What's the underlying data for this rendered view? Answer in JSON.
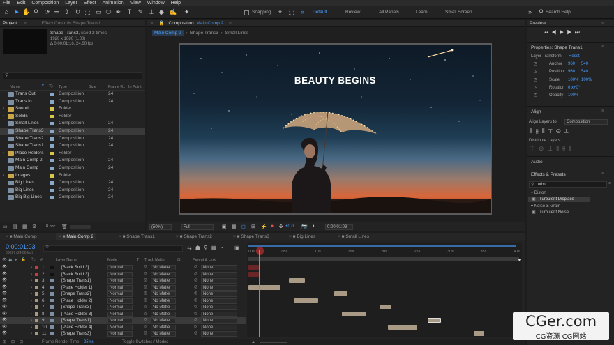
{
  "menu": [
    "File",
    "Edit",
    "Composition",
    "Layer",
    "Effect",
    "Animation",
    "View",
    "Window",
    "Help"
  ],
  "toolbar": {
    "snapping": "Snapping",
    "workspaces": [
      "Default",
      "Review",
      "All Panels",
      "Learn",
      "Small Screen"
    ],
    "search_placeholder": "Search Help"
  },
  "project": {
    "tab": "Project",
    "effects_tab": "Effect Controls Shape Trans1",
    "selected": "Shape Trans3",
    "used": ", used 2 times",
    "dims": "1920 x 1080 (1.00)",
    "duration": "Δ 0:00:01:16, 24.00 fps",
    "columns": [
      "Name",
      "Type",
      "Size",
      "Frame R...",
      "In Point"
    ],
    "bpc": "8 bpc",
    "items": [
      {
        "name": "Trans Out",
        "type": "Composition",
        "rate": "24",
        "color": "#8aa8c8",
        "kind": "comp"
      },
      {
        "name": "Trans In",
        "type": "Composition",
        "rate": "24",
        "color": "#8aa8c8",
        "kind": "comp"
      },
      {
        "name": "Sound",
        "type": "Folder",
        "rate": "",
        "color": "#d8c84a",
        "kind": "folder"
      },
      {
        "name": "Solids",
        "type": "Folder",
        "rate": "",
        "color": "#d8c84a",
        "kind": "folder"
      },
      {
        "name": "Small Lines",
        "type": "Composition",
        "rate": "24",
        "color": "#8aa8c8",
        "kind": "comp"
      },
      {
        "name": "Shape Trans3",
        "type": "Composition",
        "rate": "24",
        "color": "#8aa8c8",
        "kind": "comp"
      },
      {
        "name": "Shape Trans2",
        "type": "Composition",
        "rate": "24",
        "color": "#8aa8c8",
        "kind": "comp"
      },
      {
        "name": "Shape Trans1",
        "type": "Composition",
        "rate": "24",
        "color": "#8aa8c8",
        "kind": "comp"
      },
      {
        "name": "Place Holders",
        "type": "Folder",
        "rate": "",
        "color": "#d8c84a",
        "kind": "folder"
      },
      {
        "name": "Main Comp 2",
        "type": "Composition",
        "rate": "24",
        "color": "#8aa8c8",
        "kind": "comp"
      },
      {
        "name": "Main Comp",
        "type": "Composition",
        "rate": "24",
        "color": "#8aa8c8",
        "kind": "comp"
      },
      {
        "name": "Images",
        "type": "Folder",
        "rate": "",
        "color": "#d8c84a",
        "kind": "folder"
      },
      {
        "name": "Big Lines",
        "type": "Composition",
        "rate": "24",
        "color": "#8aa8c8",
        "kind": "comp"
      },
      {
        "name": "Big Lines",
        "type": "Composition",
        "rate": "24",
        "color": "#8aa8c8",
        "kind": "comp"
      },
      {
        "name": "Big Big Lines",
        "type": "Composition",
        "rate": "24",
        "color": "#8aa8c8",
        "kind": "comp"
      }
    ]
  },
  "comp": {
    "tab_prefix": "Composition",
    "tab_name": "Main Comp 2",
    "crumbs": [
      "Main Comp 2",
      "Shape Trans3",
      "Small Lines"
    ],
    "headline": "BEAUTY BEGINS",
    "zoom": "(50%)",
    "quality": "Full",
    "exposure": "+0.0",
    "timecode": "0:00:01:03"
  },
  "preview": {
    "title": "Preview"
  },
  "properties": {
    "title": "Properties: Shape Trans1",
    "layer_transform": "Layer Transform",
    "reset": "Reset",
    "rows": [
      {
        "label": "Anchor",
        "v1": "960",
        "v2": "540"
      },
      {
        "label": "Position",
        "v1": "960",
        "v2": "540"
      },
      {
        "label": "Scale",
        "v1": "100%",
        "v2": "100%"
      },
      {
        "label": "Rotation",
        "v1": "0 x+0°",
        "v2": ""
      },
      {
        "label": "Opacity",
        "v1": "100%",
        "v2": ""
      }
    ]
  },
  "align": {
    "title": "Align",
    "align_to": "Align Layers to:",
    "target": "Composition",
    "distribute": "Distribute Layers:",
    "audio": "Audio"
  },
  "effects": {
    "title": "Effects & Presets",
    "search": "turbu",
    "groups": [
      {
        "name": "Distort",
        "items": [
          "Turbulent Displace"
        ]
      },
      {
        "name": "Noise & Grain",
        "items": [
          "Turbulent Noise"
        ]
      }
    ]
  },
  "timeline": {
    "tabs": [
      "Main Comp",
      "Main Comp 2",
      "Shape Trans1",
      "Shape Trans2",
      "Shape Trans3",
      "Big Lines",
      "Small Lines"
    ],
    "active_tab": 1,
    "time": "0:00:01:03",
    "frames": "00027 (24.00 fps)",
    "cols": [
      "Layer Name",
      "Mode",
      "T",
      "Track Matte",
      "Parent & Link"
    ],
    "ruler": [
      "00s",
      "05s",
      "10s",
      "15s",
      "20s",
      "25s",
      "30s",
      "35s",
      "40s"
    ],
    "footer_render": "Frame Render Time",
    "render_ms": "25ms",
    "toggle": "Toggle Switches / Modes",
    "layers": [
      {
        "num": "1",
        "name": "[Black Solid 3]",
        "mode": "Normal",
        "matte": "No Matte",
        "parent": "None",
        "color": "#cc3a3a",
        "bar": [
          0.0,
          0.04
        ],
        "redbar": true
      },
      {
        "num": "2",
        "name": "[Black Solid 3]",
        "mode": "Normal",
        "matte": "No Matte",
        "parent": "None",
        "color": "#cc3a3a",
        "bar": [
          0.0,
          0.04
        ],
        "redbar": true
      },
      {
        "num": "3",
        "name": "[Shape Trans1]",
        "mode": "Normal",
        "matte": "No Matte",
        "parent": "None",
        "color": "#a8987e",
        "bar": [
          0.15,
          0.21
        ]
      },
      {
        "num": "4",
        "name": "[Place Holder 1]",
        "mode": "Normal",
        "matte": "No Matte",
        "parent": "None",
        "color": "#a8987e",
        "bar": [
          0.0,
          0.12
        ]
      },
      {
        "num": "5",
        "name": "[Shape Trans2]",
        "mode": "Normal",
        "matte": "No Matte",
        "parent": "None",
        "color": "#a8987e",
        "bar": [
          0.32,
          0.37
        ]
      },
      {
        "num": "6",
        "name": "[Place Holder 2]",
        "mode": "Normal",
        "matte": "No Matte",
        "parent": "None",
        "color": "#a8987e",
        "bar": [
          0.17,
          0.26
        ]
      },
      {
        "num": "7",
        "name": "[Shape Trans3]",
        "mode": "Normal",
        "matte": "No Matte",
        "parent": "None",
        "color": "#a8987e",
        "bar": [
          0.49,
          0.53
        ]
      },
      {
        "num": "8",
        "name": "[Place Holder 3]",
        "mode": "Normal",
        "matte": "No Matte",
        "parent": "None",
        "color": "#a8987e",
        "bar": [
          0.35,
          0.44
        ]
      },
      {
        "num": "9",
        "name": "[Shape Trans1]",
        "mode": "Normal",
        "matte": "No Matte",
        "parent": "None",
        "color": "#a8987e",
        "bar": [
          0.67,
          0.72
        ],
        "selected": true
      },
      {
        "num": "10",
        "name": "[Place Holder 4]",
        "mode": "Normal",
        "matte": "No Matte",
        "parent": "None",
        "color": "#a8987e",
        "bar": [
          0.52,
          0.63
        ]
      },
      {
        "num": "11",
        "name": "[Shape Trans3]",
        "mode": "Normal",
        "matte": "No Matte",
        "parent": "None",
        "color": "#a8987e",
        "bar": [
          0.84,
          0.88
        ]
      }
    ]
  },
  "watermark": {
    "line1": "CGer.com",
    "line2": "CG资源 CG网站"
  }
}
